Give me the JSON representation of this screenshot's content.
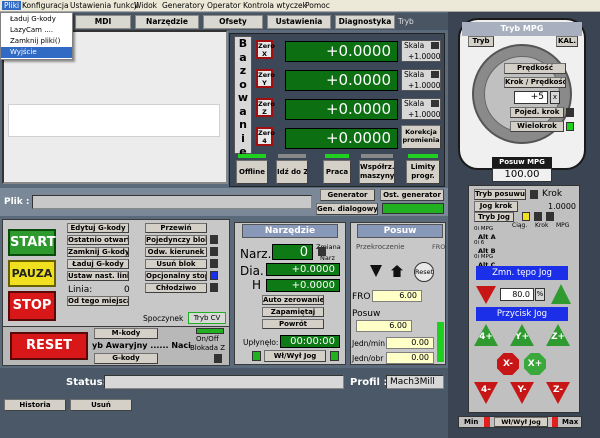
{
  "menu": {
    "items": [
      "Pliki",
      "Konfiguracja",
      "Ustawienia funkcji",
      "Widok",
      "Generatory",
      "Operator",
      "Kontrola wtyczek",
      "Pomoc"
    ],
    "dropdown": [
      "Ładuj G-kody",
      "LazyCam ....",
      "Zamknij pliki()",
      "Wyjście"
    ]
  },
  "tabs": [
    "MDI",
    "Narzędzie",
    "Ofsety",
    "Ustawienia",
    "Diagnostyka",
    "Tryb"
  ],
  "dro": {
    "bazowanie_label": "Bazowanie",
    "axes": [
      {
        "zero": "Zero\nX",
        "value": "+0.0000",
        "skala": "+1.0000"
      },
      {
        "zero": "Zero\nY",
        "value": "+0.0000",
        "skala": "+1.0000"
      },
      {
        "zero": "Zero\nZ",
        "value": "+0.0000",
        "skala": "+1.0000"
      },
      {
        "zero": "Zero\n4",
        "value": "+0.0000"
      }
    ],
    "skala_label": "Skala",
    "korekcja_label": "Korekcja promienia",
    "buttons": [
      "Offline",
      "Idź do Z",
      "Praca",
      "Współrz. maszyny",
      "Limity progr."
    ]
  },
  "generator": {
    "generator_label": "Generator",
    "ost_generator": "Ost. generator",
    "gen_dialogowy": "Gen. dialogowy"
  },
  "plik_label": "Plik :",
  "controls": {
    "start": "START",
    "pauza": "PAUZA",
    "stop": "STOP",
    "reset": "RESET",
    "buttons_col1": [
      "Edytuj G-kody",
      "Ostatnio otwarty",
      "Zamknij G-kody",
      "Ładuj G-kody",
      "Ustaw nast. linię"
    ],
    "linia_label": "Linia:",
    "linia_value": "0",
    "od_tego_miejsca": "Od tego miejsca",
    "buttons_col2": [
      "Przewiń",
      "Pojedynczy blok",
      "Odw. kierunek",
      "Usuń blok",
      "Opcjonalny stop",
      "Chłodziwo"
    ],
    "spoczynek": "Spoczynek",
    "tryb_cv": "Tryb CV",
    "m_kody": "M-kody",
    "on_off": "On/Off",
    "blokada_z": "Blokada Z",
    "g_kody": "G-kody",
    "awaryjny": "yb Awaryjny ...... Naci",
    "status_label": "Status:",
    "profil_label": "Profil :",
    "profil_value": "Mach3Mill",
    "historia": "Historia",
    "usun": "Usuń"
  },
  "narzedzie": {
    "title": "Narzędzie",
    "narz_label": "Narz.",
    "narz_value": "0",
    "zmiana": "Zmiana",
    "narz_small": "Narz",
    "dia_label": "Dia.",
    "dia_value": "+0.0000",
    "h_label": "H",
    "h_value": "+0.0000",
    "auto_zerowanie": "Auto zerowanie",
    "zapamietaj": "Zapamiętaj",
    "powrot": "Powrót",
    "uplynelo_label": "Upłynęło:",
    "uplynelo_value": "00:00:00",
    "wl_wyl_jog": "Wł/Wył Jog"
  },
  "posuw": {
    "title": "Posuw",
    "przekroczenie": "Przekroczenie",
    "fro_short": "FRO",
    "reset": "Reset",
    "fro_label": "FRO",
    "fro_value": "6.00",
    "posuw_label": "Posuw",
    "posuw_value": "6.00",
    "jedn_min": "Jedn/min",
    "jedn_min_value": "0.00",
    "jedn_obr": "Jedn/obr",
    "jedn_obr_value": "0.00"
  },
  "mpg": {
    "title": "Tryb MPG",
    "tryb": "Tryb",
    "kal": "KAL.",
    "predkosc": "Prędkość",
    "krok_predkosc": "Krok / Prędkość",
    "step_value": "+5",
    "poj_krok": "Pojed. krok",
    "wielokrok": "Wielokrok",
    "posuw_mpg": "Posuw MPG",
    "posuw_mpg_value": "100.00",
    "tryb_posuwu": "Tryb posuwu",
    "krok_label": "Krok",
    "jog_krok": "Jog krok",
    "jog_krok_value": "1.0000",
    "tryb_jog": "Tryb Jog",
    "headers": [
      "Ciąg.",
      "Krok",
      "MPG"
    ],
    "rows": [
      "0i MPG",
      "Alt A",
      "0i 6",
      "Alt B",
      "0i MPG",
      "Alt C"
    ],
    "zmn_tepo_jog": "Zmn. tępo Jog",
    "jog_pct": "80.0",
    "pct": "%",
    "przycisk_jog": "Przycisk Jog",
    "jog_buttons": [
      "4+",
      "Y+",
      "Z+",
      "X-",
      "X+",
      "4-",
      "Y-",
      "Z-"
    ],
    "min": "Min",
    "wl_wyl_jog": "Wł/Wył Jog",
    "max": "Max"
  },
  "colors": {
    "dro_green": "#0c6f12",
    "led_green": "#20d020",
    "led_red": "#e02020",
    "start": "#2e9a2e",
    "pauza": "#f0e020",
    "stop": "#d81818",
    "jog_blue": "#1c2fe8"
  }
}
